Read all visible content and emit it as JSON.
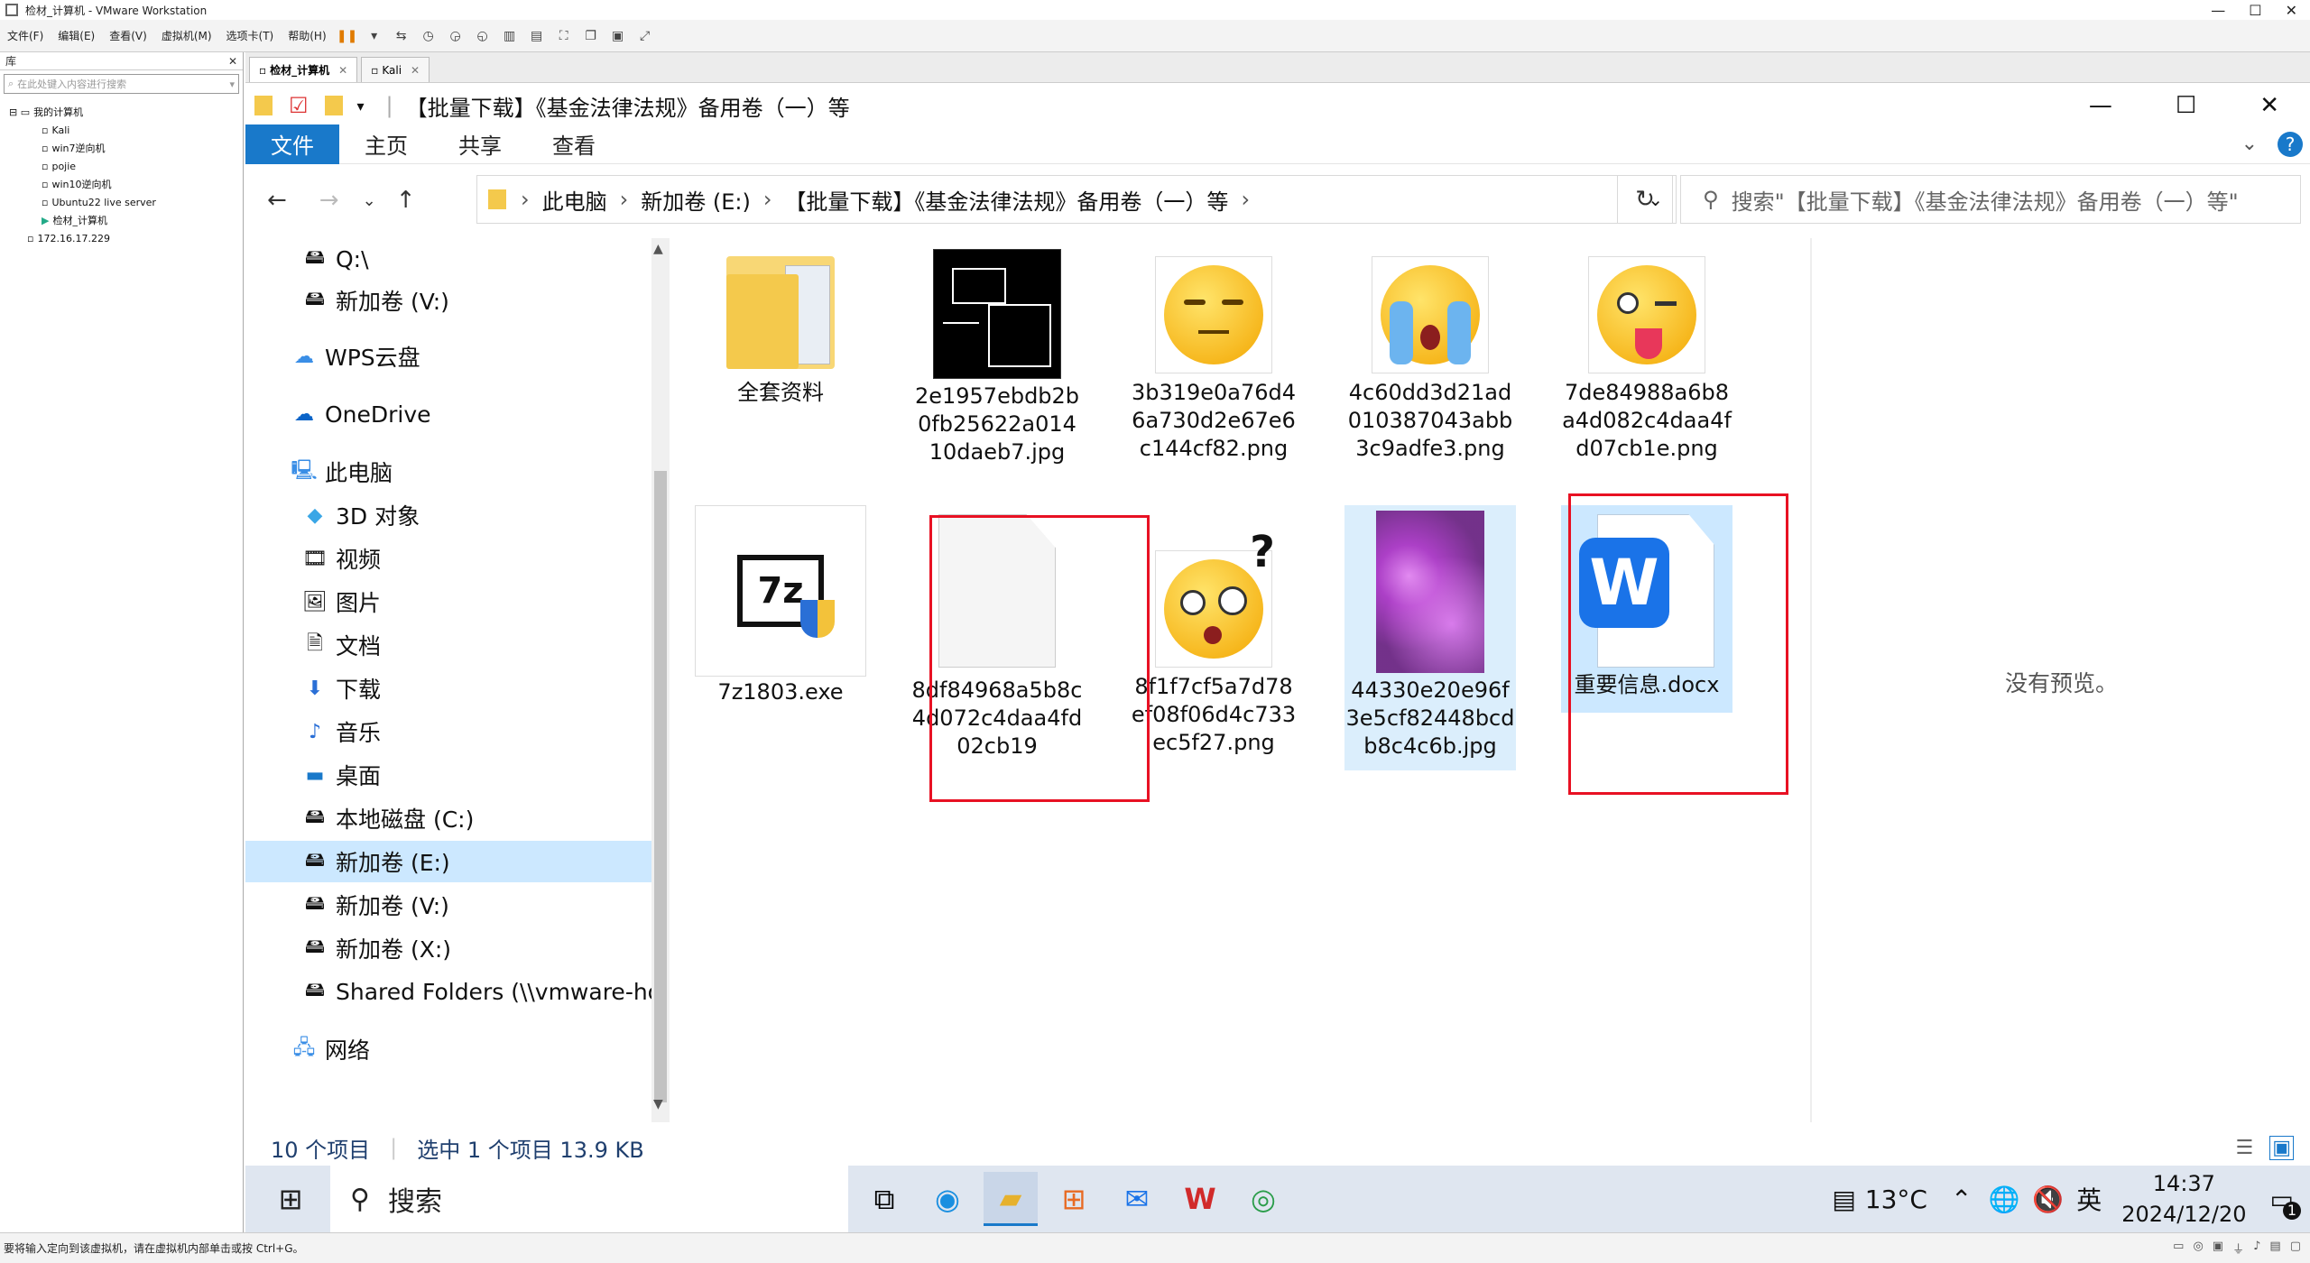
{
  "vmware": {
    "window_title": "检材_计算机 - VMware Workstation",
    "menu": [
      "文件(F)",
      "编辑(E)",
      "查看(V)",
      "虚拟机(M)",
      "选项卡(T)",
      "帮助(H)"
    ],
    "library_title": "库",
    "library_search_placeholder": "在此处键入内容进行搜索",
    "tree": [
      "我的计算机",
      "Kali",
      "win7逆向机",
      "pojie",
      "win10逆向机",
      "Ubuntu22 live server",
      "检材_计算机",
      "172.16.17.229"
    ],
    "tabs": [
      "检材_计算机",
      "Kali"
    ],
    "status_hint": "要将输入定向到该虚拟机，请在虚拟机内部单击或按 Ctrl+G。"
  },
  "explorer": {
    "window_title": "【批量下载】《基金法律法规》备用卷（一）等",
    "ribbon_tabs": [
      "文件",
      "主页",
      "共享",
      "查看"
    ],
    "breadcrumb": [
      "此电脑",
      "新加卷 (E:)",
      "【批量下载】《基金法律法规》备用卷（一）等"
    ],
    "search_placeholder": "搜索\"【批量下载】《基金法律法规》备用卷（一）等\"",
    "nav": [
      "Q:\\",
      "新加卷 (V:)",
      "WPS云盘",
      "OneDrive",
      "此电脑",
      "3D 对象",
      "视频",
      "图片",
      "文档",
      "下载",
      "音乐",
      "桌面",
      "本地磁盘 (C:)",
      "新加卷 (E:)",
      "新加卷 (V:)",
      "新加卷 (X:)",
      "Shared Folders (\\\\vmware-host",
      "网络"
    ],
    "files": [
      {
        "name": "全套资料"
      },
      {
        "name": "2e1957ebdb2b0fb25622a01410daeb7.jpg"
      },
      {
        "name": "3b319e0a76d46a730d2e67e6c144cf82.png"
      },
      {
        "name": "4c60dd3d21ad010387043abb3c9adfe3.png"
      },
      {
        "name": "7de84988a6b8a4d082c4daa4fd07cb1e.png"
      },
      {
        "name": "7z1803.exe"
      },
      {
        "name": "8df84968a5b8c4d072c4daa4fd02cb19"
      },
      {
        "name": "8f1f7cf5a7d78ef08f06d4c733ec5f27.png"
      },
      {
        "name": "44330e20e96f3e5cf82448bcdb8c4c6b.jpg"
      },
      {
        "name": "重要信息.docx"
      }
    ],
    "preview": "没有预览。",
    "status_count": "10 个项目",
    "status_selected": "选中 1 个项目  13.9 KB"
  },
  "taskbar": {
    "search_label": "搜索",
    "weather": "13°C",
    "ime": "英",
    "time": "14:37",
    "date": "2024/12/20",
    "notification_count": "1"
  },
  "colors": {
    "accent": "#1979ca",
    "selection": "#cce8ff",
    "highlight_box": "#e81123"
  }
}
